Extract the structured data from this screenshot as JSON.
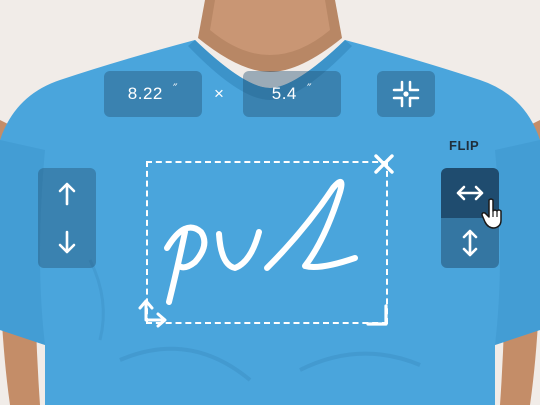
{
  "colors": {
    "shirt": "#4aa5dc",
    "background": "#f1ece8",
    "panel": "#2a5a80",
    "panel_active": "#1f4c6f",
    "handle": "#ffffff"
  },
  "size_panel": {
    "width_value": "8.22",
    "height_value": "5.4",
    "unit": "″",
    "separator": "×",
    "center_icon": "center-align-icon"
  },
  "move_panel": {
    "up_icon": "arrow-up-icon",
    "down_icon": "arrow-down-icon"
  },
  "flip_panel": {
    "label": "FLIP",
    "horizontal_icon": "flip-horizontal-icon",
    "vertical_icon": "flip-vertical-icon"
  },
  "design": {
    "logo_text": "pvl",
    "delete_icon": "close-icon",
    "rotate_icon": "rotate-icon",
    "resize_icon": "resize-corner-icon"
  }
}
